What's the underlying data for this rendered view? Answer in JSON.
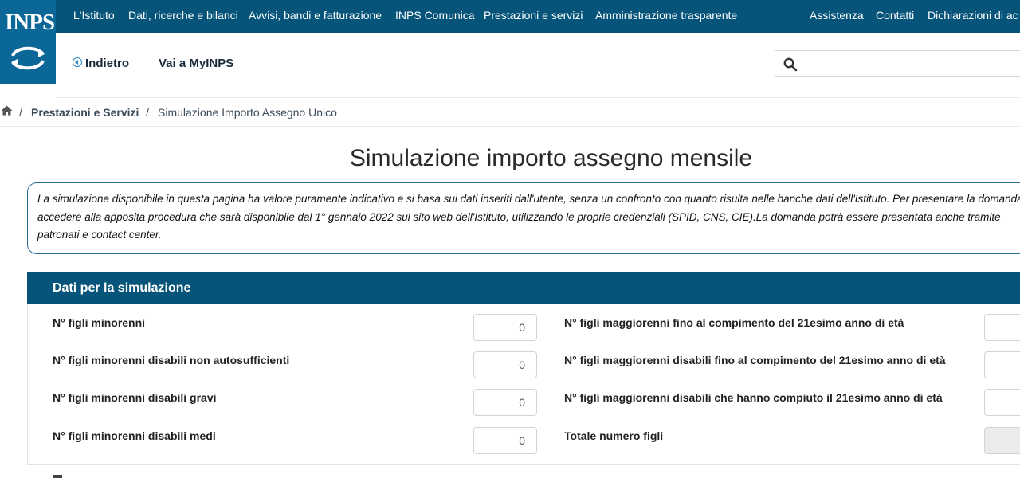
{
  "logo": {
    "text": "INPS"
  },
  "topnav": {
    "items": [
      "L'Istituto",
      "Dati, ricerche e bilanci",
      "Avvisi, bandi e fatturazione",
      "INPS Comunica",
      "Prestazioni e servizi",
      "Amministrazione trasparente"
    ],
    "right_items": [
      "Assistenza",
      "Contatti",
      "Dichiarazioni di ac"
    ]
  },
  "subnav": {
    "back_label": "Indietro",
    "myinps_label": "Vai a MyINPS"
  },
  "search": {
    "value": "",
    "placeholder": ""
  },
  "breadcrumb": {
    "items": [
      "Prestazioni e Servizi",
      "Simulazione Importo Assegno Unico"
    ]
  },
  "page": {
    "title": "Simulazione importo assegno mensile",
    "notice": " La simulazione disponibile in questa pagina ha valore puramente indicativo e si basa sui dati inseriti dall'utente, senza un confronto con quanto risulta nelle banche dati dell'Istituto. Per presentare la domanda accedere alla apposita procedura che sarà disponibile dal 1° gennaio 2022 sul sito web dell'Istituto, utilizzando le proprie credenziali (SPID, CNS, CIE).La domanda potrà essere presentata anche tramite patronati e contact center."
  },
  "form": {
    "title": "Dati per la simulazione",
    "left_fields": [
      {
        "label": "N° figli minorenni",
        "value": "0"
      },
      {
        "label": "N° figli minorenni disabili non autosufficienti",
        "value": "0"
      },
      {
        "label": "N° figli minorenni disabili gravi",
        "value": "0"
      },
      {
        "label": "N° figli minorenni disabili medi",
        "value": "0"
      }
    ],
    "right_fields": [
      {
        "label": "N° figli maggiorenni fino al compimento del 21esimo anno di età",
        "value": ""
      },
      {
        "label": "N° figli maggiorenni disabili fino al compimento del 21esimo anno di età",
        "value": ""
      },
      {
        "label": "N° figli maggiorenni disabili che hanno compiuto il 21esimo anno di età",
        "value": ""
      },
      {
        "label": "Totale numero figli",
        "value": ""
      }
    ]
  },
  "colors": {
    "nav_bg": "#06547a",
    "logo_bg": "#0a6797",
    "link_blue": "#2a86c2"
  },
  "icons": [
    "inps-logo-icon",
    "back-circle-icon",
    "search-icon",
    "home-icon"
  ]
}
